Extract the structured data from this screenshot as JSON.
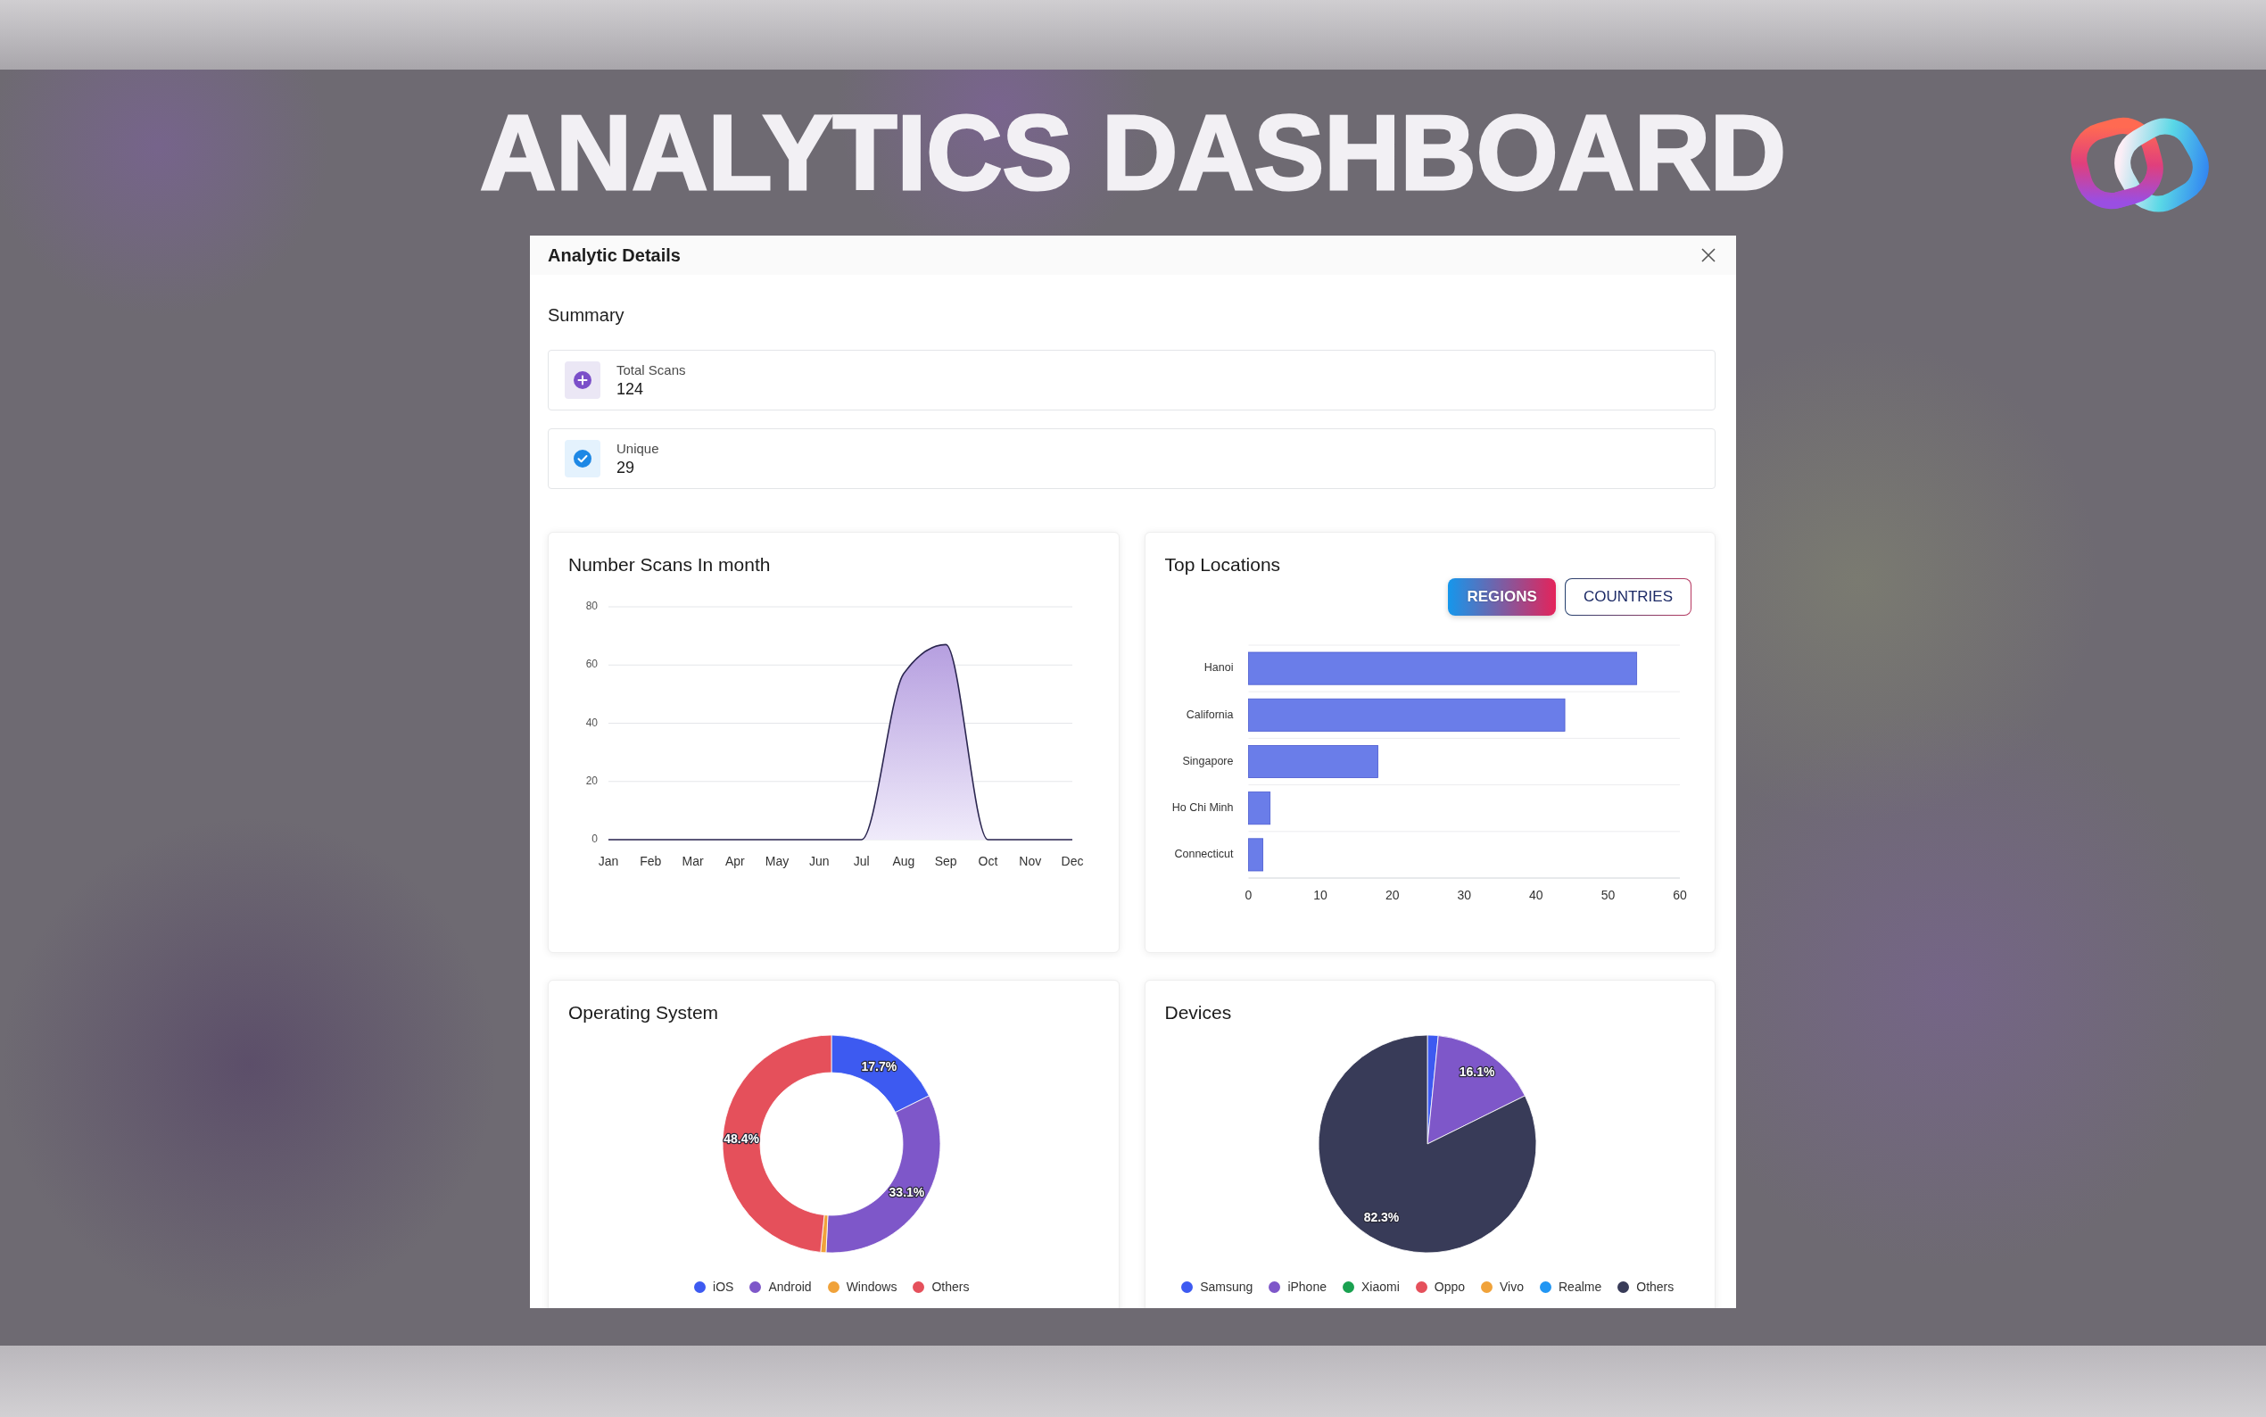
{
  "banner": {
    "title": "ANALYTICS DASHBOARD"
  },
  "dialog": {
    "title": "Analytic Details",
    "summary": {
      "heading": "Summary",
      "stats": [
        {
          "kind": "total",
          "label": "Total Scans",
          "value": "124"
        },
        {
          "kind": "unique",
          "label": "Unique",
          "value": "29"
        }
      ]
    },
    "scans_by_month": {
      "title": "Number Scans In month",
      "chart_data": {
        "type": "area",
        "categories": [
          "Jan",
          "Feb",
          "Mar",
          "Apr",
          "May",
          "Jun",
          "Jul",
          "Aug",
          "Sep",
          "Oct",
          "Nov",
          "Dec"
        ],
        "values": [
          0,
          0,
          0,
          0,
          0,
          0,
          0,
          57,
          67,
          0,
          0,
          0
        ],
        "ylim": [
          0,
          80
        ],
        "yticks": [
          0,
          20,
          40,
          60,
          80
        ],
        "grid": true
      }
    },
    "top_locations": {
      "title": "Top Locations",
      "tabs": [
        {
          "label": "REGIONS",
          "selected": true
        },
        {
          "label": "COUNTRIES",
          "selected": false
        }
      ],
      "chart_data": {
        "type": "bar",
        "orientation": "horizontal",
        "categories": [
          "Hanoi",
          "California",
          "Singapore",
          "Ho Chi Minh",
          "Connecticut"
        ],
        "values": [
          54,
          44,
          18,
          3,
          2
        ],
        "xlim": [
          0,
          60
        ],
        "xticks": [
          0,
          10,
          20,
          30,
          40,
          50,
          60
        ],
        "grid": true
      }
    },
    "operating_system": {
      "title": "Operating System",
      "chart_data": {
        "type": "donut",
        "categories": [
          "iOS",
          "Android",
          "Windows",
          "Others"
        ],
        "values": [
          17.7,
          33.1,
          0.8,
          48.4
        ],
        "colors": [
          "#3d5af1",
          "#7e57c9",
          "#f0a23a",
          "#e5505b"
        ],
        "value_labels": [
          "17.7%",
          "33.1%",
          null,
          "48.4%"
        ],
        "legend": "bottom"
      }
    },
    "devices": {
      "title": "Devices",
      "chart_data": {
        "type": "pie",
        "categories": [
          "Samsung",
          "iPhone",
          "Xiaomi",
          "Oppo",
          "Vivo",
          "Realme",
          "Others"
        ],
        "values": [
          1.6,
          16.1,
          0,
          0,
          0,
          0,
          82.3
        ],
        "colors": [
          "#3d5af1",
          "#7e57c9",
          "#1aa150",
          "#e5505b",
          "#f0a23a",
          "#2196f3",
          "#383b58"
        ],
        "value_labels": [
          null,
          "16.1%",
          null,
          null,
          null,
          null,
          "82.3%"
        ],
        "legend": "bottom"
      }
    }
  }
}
